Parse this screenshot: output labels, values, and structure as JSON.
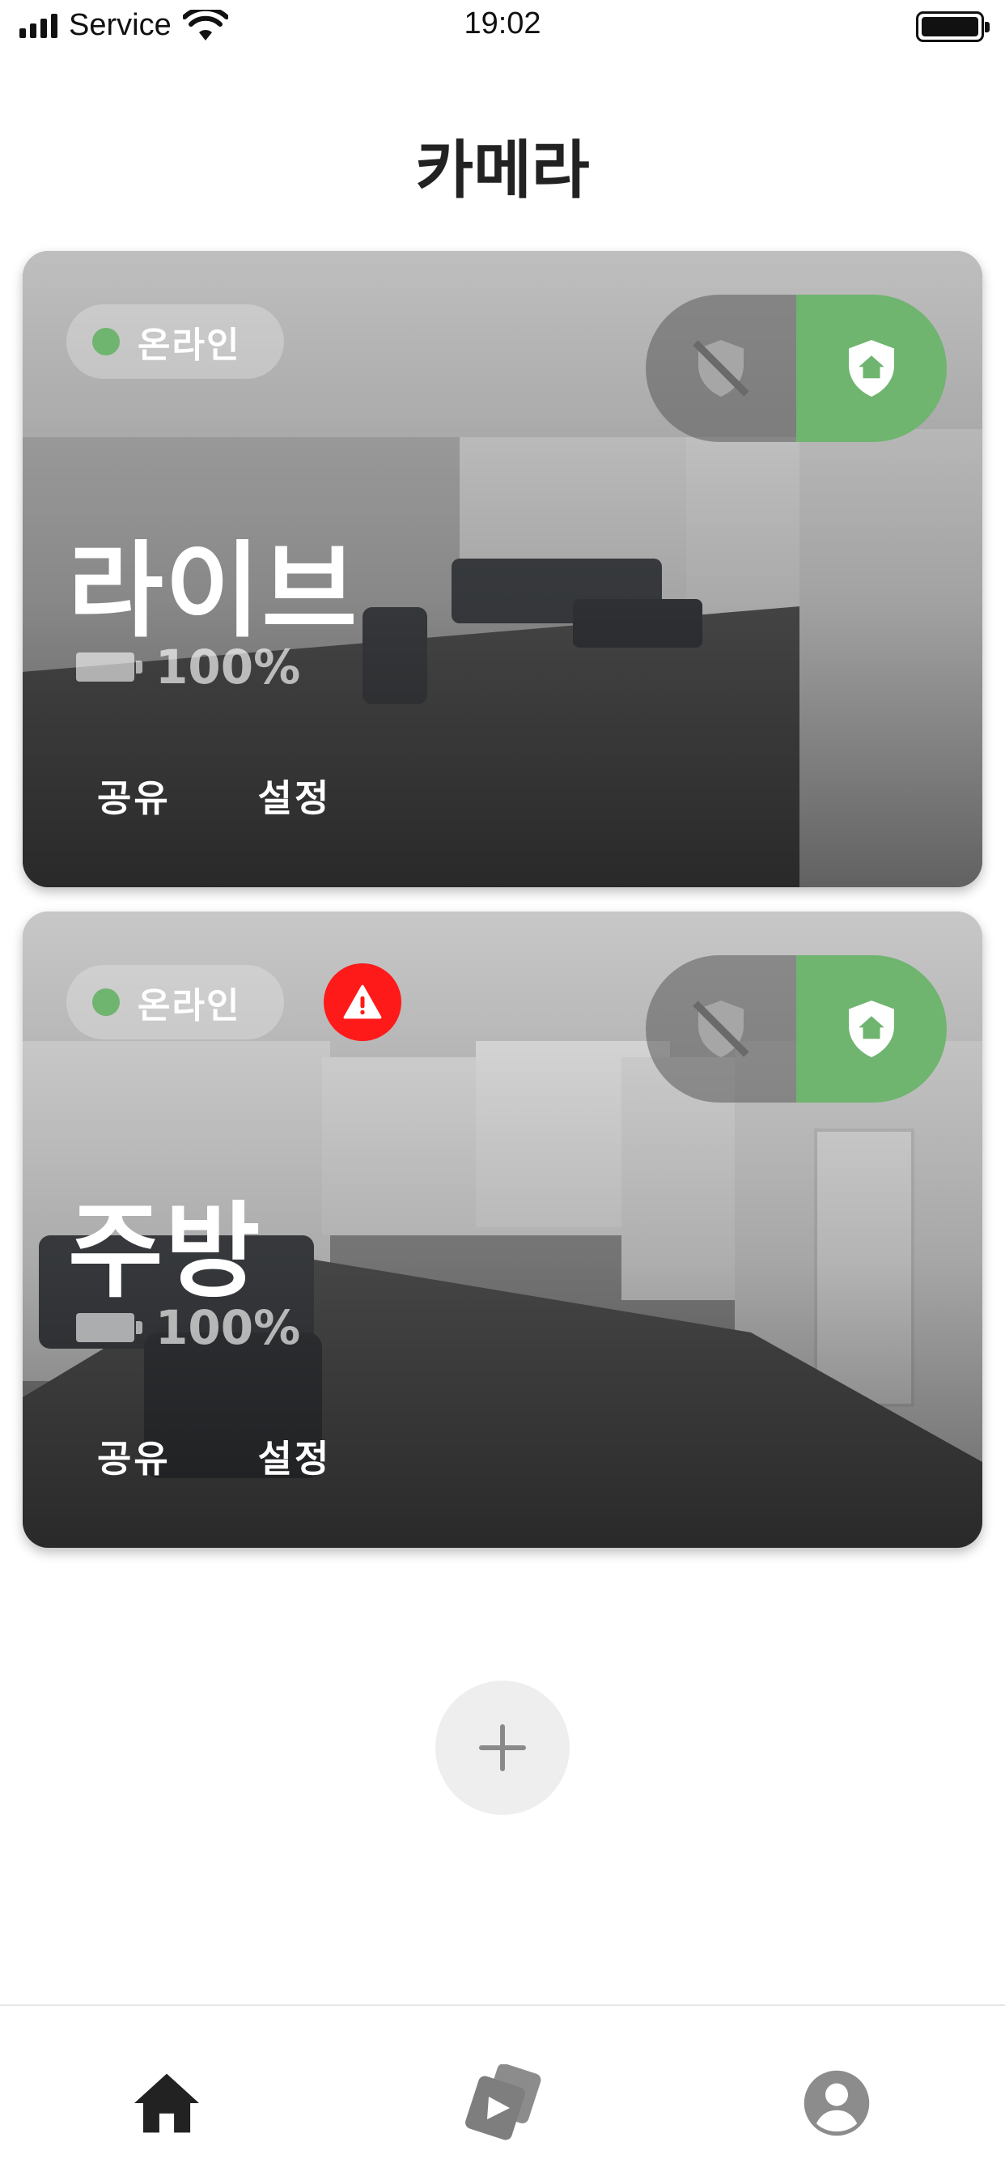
{
  "status_bar": {
    "carrier": "Service",
    "time": "19:02",
    "signal_icon": "signal-bars-icon",
    "wifi_icon": "wifi-icon",
    "battery_icon": "battery-full-icon"
  },
  "page": {
    "title": "카메라"
  },
  "cameras": [
    {
      "status": "온라인",
      "status_color": "#6fb46f",
      "name": "라이브",
      "battery": "100%",
      "share_label": "공유",
      "settings_label": "설정",
      "alert": false,
      "mode_selected": "home"
    },
    {
      "status": "온라인",
      "status_color": "#6fb46f",
      "name": "주방",
      "battery": "100%",
      "share_label": "공유",
      "settings_label": "설정",
      "alert": true,
      "alert_color": "#ff1a1a",
      "mode_selected": "home"
    }
  ],
  "colors": {
    "accent": "#6fb46f",
    "alert": "#ff1a1a"
  },
  "tab_bar": {
    "tabs": [
      {
        "icon": "home-icon",
        "active": true
      },
      {
        "icon": "media-cards-icon",
        "active": false
      },
      {
        "icon": "profile-icon",
        "active": false
      }
    ]
  }
}
